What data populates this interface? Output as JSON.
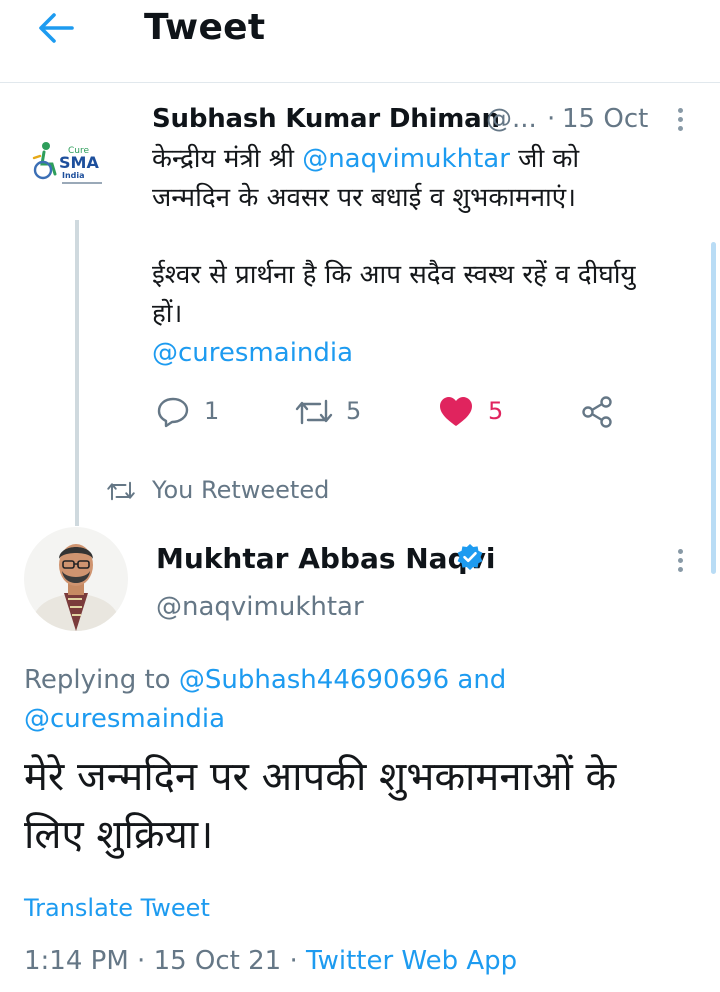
{
  "header": {
    "title": "Tweet",
    "back_icon": "arrow-left-icon"
  },
  "parent_tweet": {
    "author_name": "Subhash Kumar Dhiman",
    "author_handle": "@...",
    "dot": "·",
    "date": "15 Oct",
    "avatar_logo_text": {
      "cure": "Cure",
      "sma": "SMA",
      "india": "India"
    },
    "body": {
      "line1_prefix": "केन्द्रीय मंत्री श्री ",
      "line1_mention": "@naqvimukhtar",
      "line1_suffix": " जी को",
      "line2": "जन्मदिन के अवसर पर बधाई व शुभकामनाएं।",
      "line3": "ईश्वर से प्रार्थना है कि आप सदैव स्वस्थ रहें व दीर्घायु",
      "line4": "हों।",
      "line5_mention": "@curesmaindia"
    },
    "actions": {
      "replies": "1",
      "retweets": "5",
      "likes": "5"
    },
    "colors": {
      "like": "#e0245e",
      "retweet_count": "#657786"
    }
  },
  "retweet_banner": {
    "label": "You Retweeted"
  },
  "main_tweet": {
    "author_name": "Mukhtar Abbas Naqvi",
    "author_handle": "@naqvimukhtar",
    "replying_prefix": "Replying to ",
    "replying_mention1": "@Subhash44690696",
    "replying_and": " and",
    "replying_mention2": "@curesmaindia",
    "body_line1": "मेरे जन्मदिन पर आपकी शुभकामनाओं के",
    "body_line2": "लिए शुक्रिया।",
    "translate": "Translate Tweet",
    "time": "1:14 PM",
    "sep1": " · ",
    "date": "15 Oct 21",
    "sep2": " · ",
    "source": "Twitter Web App"
  },
  "accent": "#1d9bf0"
}
